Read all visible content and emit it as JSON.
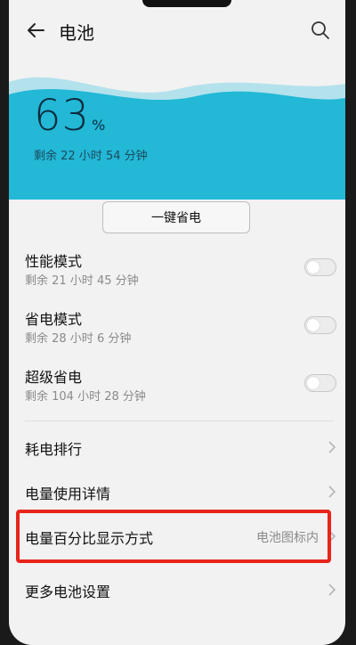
{
  "header": {
    "title": "电池"
  },
  "battery": {
    "percent": "63",
    "percent_sign": "%",
    "remaining": "剩余 22 小时 54 分钟"
  },
  "power_save_button": "一键省电",
  "modes": [
    {
      "title": "性能模式",
      "subtitle": "剩余 21 小时 45 分钟",
      "enabled": false
    },
    {
      "title": "省电模式",
      "subtitle": "剩余 28 小时 6 分钟",
      "enabled": false
    },
    {
      "title": "超级省电",
      "subtitle": "剩余 104 小时 28 分钟",
      "enabled": false
    }
  ],
  "menu": [
    {
      "label": "耗电排行",
      "value": ""
    },
    {
      "label": "电量使用详情",
      "value": ""
    },
    {
      "label": "电量百分比显示方式",
      "value": "电池图标内"
    },
    {
      "label": "更多电池设置",
      "value": ""
    }
  ],
  "colors": {
    "wave": "#22b8d6",
    "highlight": "#e8251b"
  },
  "icons": {
    "back": "back-arrow-icon",
    "search": "search-icon",
    "chevron": "chevron-right-icon"
  }
}
